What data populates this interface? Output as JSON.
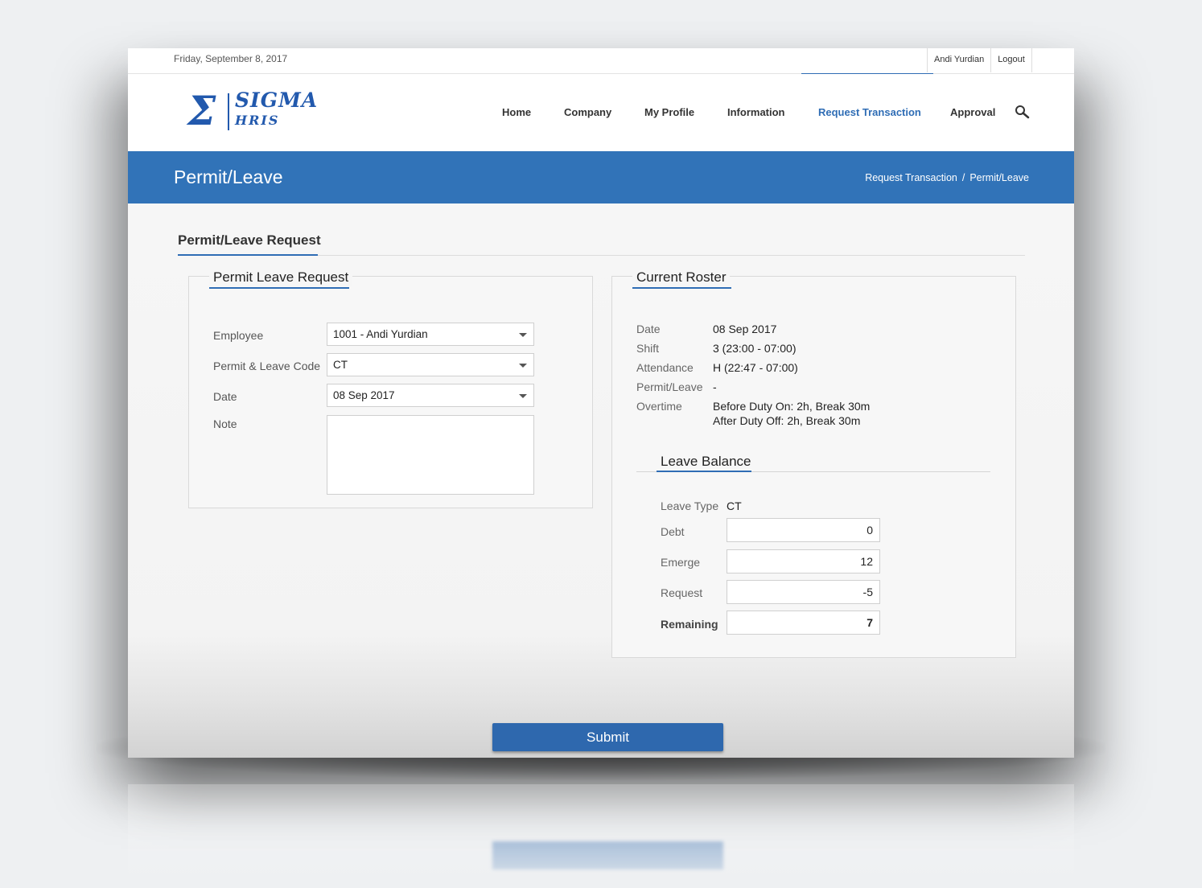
{
  "topbar": {
    "date": "Friday, September 8, 2017",
    "user_name": "Andi Yurdian",
    "logout": "Logout"
  },
  "logo": {
    "symbol": "Σ",
    "title": "SIGMA",
    "subtitle": "HRIS"
  },
  "nav": {
    "items": [
      {
        "label": "Home"
      },
      {
        "label": "Company"
      },
      {
        "label": "My Profile"
      },
      {
        "label": "Information"
      },
      {
        "label": "Request Transaction"
      },
      {
        "label": "Approval"
      }
    ],
    "active": "Request Transaction",
    "search_icon": "search-icon"
  },
  "banner": {
    "title": "Permit/Leave",
    "breadcrumb": [
      "Request Transaction",
      "Permit/Leave"
    ],
    "separator": "/"
  },
  "section": {
    "title": "Permit/Leave Request"
  },
  "request_panel": {
    "title": "Permit Leave Request",
    "employee_label": "Employee",
    "employee_value": "1001 - Andi Yurdian",
    "code_label": "Permit & Leave Code",
    "code_value": "CT",
    "date_label": "Date",
    "date_value": "08 Sep 2017",
    "note_label": "Note",
    "note_value": ""
  },
  "roster_panel": {
    "title": "Current Roster",
    "rows": [
      {
        "label": "Date",
        "value": "08 Sep 2017"
      },
      {
        "label": "Shift",
        "value": "3 (23:00 - 07:00)"
      },
      {
        "label": "Attendance",
        "value": "H (22:47 - 07:00)"
      },
      {
        "label": "Permit/Leave",
        "value": "-"
      },
      {
        "label": "Overtime",
        "value": "Before Duty On: 2h, Break 30m",
        "value2": "After Duty Off: 2h, Break 30m"
      }
    ]
  },
  "leave_balance": {
    "title": "Leave Balance",
    "leave_type_label": "Leave Type",
    "leave_type_value": "CT",
    "debt_label": "Debt",
    "debt_value": "0",
    "emerge_label": "Emerge",
    "emerge_value": "12",
    "request_label": "Request",
    "request_value": "-5",
    "remaining_label": "Remaining",
    "remaining_value": "7"
  },
  "actions": {
    "submit": "Submit"
  },
  "colors": {
    "primary": "#3173b8",
    "accent": "#2f6db5",
    "button": "#2e68ae"
  }
}
